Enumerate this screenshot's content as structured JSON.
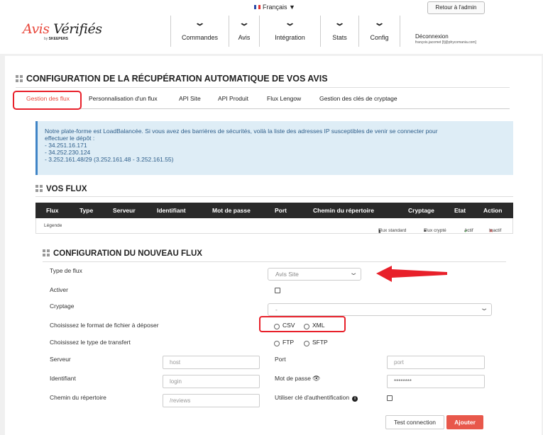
{
  "header": {
    "logo_main_a": "Avis",
    "logo_main_b": "Vérifiés",
    "logo_sub_by": "by",
    "logo_sub_brand": "SKEEPERS",
    "language": "Français ▼",
    "back_admin": "Retour à l'admin",
    "nav": [
      "Commandes",
      "Avis",
      "Intégration",
      "Stats",
      "Config"
    ],
    "deconnexion": "Déconnexion",
    "user": "françois.jacomet [fj@phycomania.com]"
  },
  "page": {
    "title": "CONFIGURATION DE LA RÉCUPÉRATION AUTOMATIQUE DE VOS AVIS",
    "tabs": [
      "Gestion des flux",
      "Personnalisation d'un flux",
      "API Site",
      "API Produit",
      "Flux Lengow",
      "Gestion des clés de cryptage"
    ]
  },
  "info": {
    "line1": "Notre plate-forme est LoadBalancée. Si vous avez des barrières de sécurités, voilà la liste des adresses IP susceptibles de venir se connecter pour",
    "line2": "effectuer le dépôt :",
    "ips": [
      "- 34.251.16.171",
      "- 34.252.230.124",
      "- 3.252.161.48/29 (3.252.161.48 - 3.252.161.55)"
    ]
  },
  "vos_flux": {
    "title": "VOS FLUX",
    "columns": [
      "Flux",
      "Type",
      "Serveur",
      "Identifiant",
      "Mot de passe",
      "Port",
      "Chemin du répertoire",
      "Cryptage",
      "Etat",
      "Action"
    ],
    "legend": {
      "label": "Légende",
      "standard": "Flux standard",
      "crypte": "Flux crypté",
      "actif": "Actif",
      "inactif": "Inactif"
    }
  },
  "new_flux": {
    "title": "CONFIGURATION DU NOUVEAU FLUX",
    "type_label": "Type de flux",
    "type_value": "Avis Site",
    "activer_label": "Activer",
    "cryptage_label": "Cryptage",
    "cryptage_value": "-",
    "format_label": "Choisissez le format de fichier à déposer",
    "format_options": [
      "CSV",
      "XML"
    ],
    "transfer_label": "Choisissez le type de transfert",
    "transfer_options": [
      "FTP",
      "SFTP"
    ],
    "serveur_label": "Serveur",
    "serveur_placeholder": "host",
    "port_label": "Port",
    "port_placeholder": "port",
    "identifiant_label": "Identifiant",
    "identifiant_placeholder": "login",
    "password_label": "Mot de passe",
    "password_value": "********",
    "chemin_label": "Chemin du répertoire",
    "chemin_placeholder": "/reviews",
    "cle_label": "Utiliser clé d'authentification",
    "test_button": "Test connection",
    "add_button": "Ajouter"
  },
  "colors": {
    "accent": "#e8483c",
    "highlight": "#e8202a",
    "info_bg": "#deedf6",
    "info_border": "#3f84c6"
  }
}
